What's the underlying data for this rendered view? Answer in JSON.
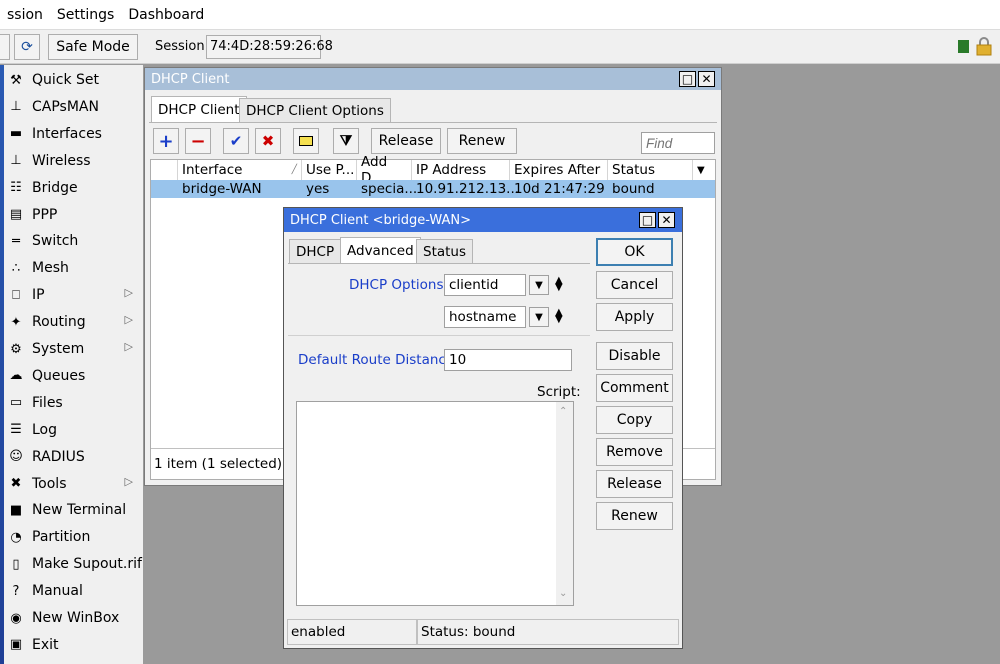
{
  "menu": [
    "ssion",
    "Settings",
    "Dashboard"
  ],
  "toolbar": {
    "safe_mode": "Safe Mode",
    "session_label": "Session:",
    "session_value": "74:4D:28:59:26:68"
  },
  "sidebar": [
    {
      "label": "Quick Set",
      "icon": "quick-set-icon",
      "glyph": "⚒",
      "arrow": false
    },
    {
      "label": "CAPsMAN",
      "icon": "capsman-icon",
      "glyph": "⊥",
      "arrow": false
    },
    {
      "label": "Interfaces",
      "icon": "interfaces-icon",
      "glyph": "▬",
      "arrow": false
    },
    {
      "label": "Wireless",
      "icon": "wireless-icon",
      "glyph": "⊥",
      "arrow": false
    },
    {
      "label": "Bridge",
      "icon": "bridge-icon",
      "glyph": "☷",
      "arrow": false
    },
    {
      "label": "PPP",
      "icon": "ppp-icon",
      "glyph": "▤",
      "arrow": false
    },
    {
      "label": "Switch",
      "icon": "switch-icon",
      "glyph": "═",
      "arrow": false
    },
    {
      "label": "Mesh",
      "icon": "mesh-icon",
      "glyph": "∴",
      "arrow": false
    },
    {
      "label": "IP",
      "icon": "ip-icon",
      "glyph": "⎕",
      "arrow": true
    },
    {
      "label": "Routing",
      "icon": "routing-icon",
      "glyph": "✦",
      "arrow": true
    },
    {
      "label": "System",
      "icon": "system-icon",
      "glyph": "⚙",
      "arrow": true
    },
    {
      "label": "Queues",
      "icon": "queues-icon",
      "glyph": "☁",
      "arrow": false
    },
    {
      "label": "Files",
      "icon": "files-icon",
      "glyph": "▭",
      "arrow": false
    },
    {
      "label": "Log",
      "icon": "log-icon",
      "glyph": "☰",
      "arrow": false
    },
    {
      "label": "RADIUS",
      "icon": "radius-icon",
      "glyph": "☺",
      "arrow": false
    },
    {
      "label": "Tools",
      "icon": "tools-icon",
      "glyph": "✖",
      "arrow": true
    },
    {
      "label": "New Terminal",
      "icon": "terminal-icon",
      "glyph": "■",
      "arrow": false
    },
    {
      "label": "Partition",
      "icon": "partition-icon",
      "glyph": "◔",
      "arrow": false
    },
    {
      "label": "Make Supout.rif",
      "icon": "supout-icon",
      "glyph": "▯",
      "arrow": false
    },
    {
      "label": "Manual",
      "icon": "manual-icon",
      "glyph": "?",
      "arrow": false
    },
    {
      "label": "New WinBox",
      "icon": "winbox-icon",
      "glyph": "◉",
      "arrow": false
    },
    {
      "label": "Exit",
      "icon": "exit-icon",
      "glyph": "▣",
      "arrow": false
    }
  ],
  "dhcp_window": {
    "title": "DHCP Client",
    "tabs": [
      "DHCP Client",
      "DHCP Client Options"
    ],
    "release": "Release",
    "renew": "Renew",
    "find_placeholder": "Find",
    "columns": [
      "Interface",
      "Use P...",
      "Add D...",
      "IP Address",
      "Expires After",
      "Status"
    ],
    "rows": [
      {
        "interface": "bridge-WAN",
        "use_peer": "yes",
        "add_default": "specia...",
        "ip": "10.91.212.13...",
        "expires": "10d 21:47:29",
        "status": "bound"
      }
    ],
    "footer": "1 item (1 selected)"
  },
  "dialog": {
    "title": "DHCP Client <bridge-WAN>",
    "tabs": [
      "DHCP",
      "Advanced",
      "Status"
    ],
    "dhcp_options_label": "DHCP Options:",
    "option1": "clientid",
    "option2": "hostname",
    "route_distance_label": "Default Route Distance:",
    "route_distance_value": "10",
    "script_label": "Script:",
    "buttons": {
      "ok": "OK",
      "cancel": "Cancel",
      "apply": "Apply",
      "disable": "Disable",
      "comment": "Comment",
      "copy": "Copy",
      "remove": "Remove",
      "release": "Release",
      "renew": "Renew"
    },
    "status_left": "enabled",
    "status_right": "Status: bound"
  }
}
